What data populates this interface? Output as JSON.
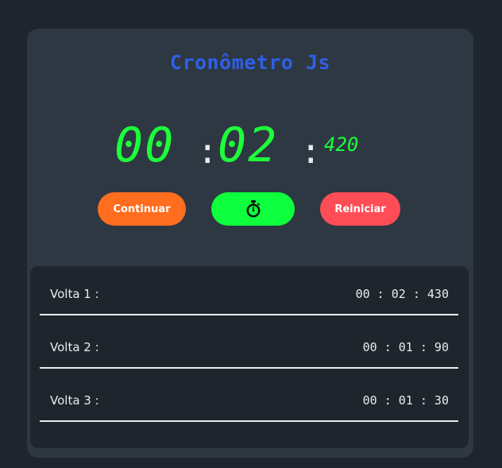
{
  "app": {
    "title": "Cronômetro Js"
  },
  "timer": {
    "minutes": "00",
    "separator1": ":",
    "seconds": "02",
    "separator2": ":",
    "milliseconds": "420"
  },
  "buttons": {
    "continue_label": "Continuar",
    "lap_icon": "stopwatch-icon",
    "reset_label": "Reiniciar"
  },
  "laps": [
    {
      "label": "Volta 1 :",
      "time": "00 : 02 : 430"
    },
    {
      "label": "Volta 2 :",
      "time": "00 : 01 : 90"
    },
    {
      "label": "Volta 3 :",
      "time": "00 : 01 : 30"
    }
  ],
  "colors": {
    "background": "#1e252d",
    "card": "#2e3842",
    "title": "#2f5fe8",
    "digits": "#1cff3a",
    "continue": "#ff6d1f",
    "lap": "#0dff3d",
    "reset": "#ff4d57"
  }
}
